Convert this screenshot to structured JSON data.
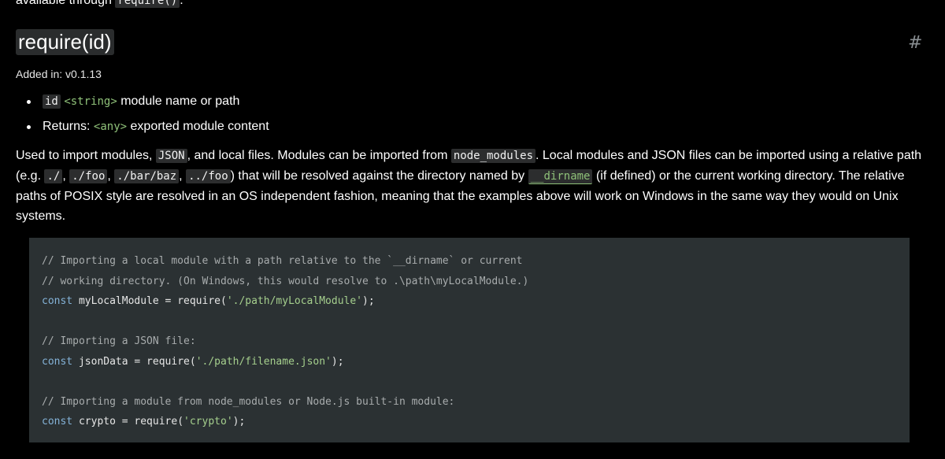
{
  "top_text": {
    "prefix": "available through",
    "code": "require()",
    "suffix": "."
  },
  "section": {
    "heading": "require(id)",
    "anchor": "#",
    "added": "Added in: v0.1.13"
  },
  "params": [
    {
      "code": "id",
      "type": "<string>",
      "description": "module name or path"
    },
    {
      "label": "Returns:",
      "type": "<any>",
      "description": "exported module content"
    }
  ],
  "paragraph": {
    "t1": "Used to import modules,",
    "c1": "JSON",
    "t2": ", and local files. Modules can be imported from",
    "c2": "node_modules",
    "t3": ". Local modules and JSON files can be imported using a relative path (e.g.",
    "c3": "./",
    "t4": ",",
    "c4": "./foo",
    "t5": ",",
    "c5": "./bar/baz",
    "t6": ",",
    "c6": "../foo",
    "t7": ") that will be resolved against the directory named by",
    "c7": "__dirname",
    "t8": "(if defined) or the current working directory. The relative paths of POSIX style are resolved in an OS independent fashion, meaning that the examples above will work on Windows in the same way they would on Unix systems."
  },
  "code": {
    "line1": "// Importing a local module with a path relative to the `__dirname` or current",
    "line2": "// working directory. (On Windows, this would resolve to .\\path\\myLocalModule.)",
    "line3_kw": "const",
    "line3_a": " myLocalModule = require(",
    "line3_str": "'./path/myLocalModule'",
    "line3_b": ");",
    "line5": "// Importing a JSON file:",
    "line6_kw": "const",
    "line6_a": " jsonData = require(",
    "line6_str": "'./path/filename.json'",
    "line6_b": ");",
    "line8": "// Importing a module from node_modules or Node.js built-in module:",
    "line9_kw": "const",
    "line9_a": " crypto = require(",
    "line9_str": "'crypto'",
    "line9_b": ");"
  },
  "colors": {
    "background": "#000000",
    "code_background": "#2b3133",
    "inline_code_background": "#2c2d2e",
    "type_link": "#8fc179",
    "keyword": "#84b3d8",
    "string": "#a5cf8d",
    "comment": "#a8acad"
  }
}
